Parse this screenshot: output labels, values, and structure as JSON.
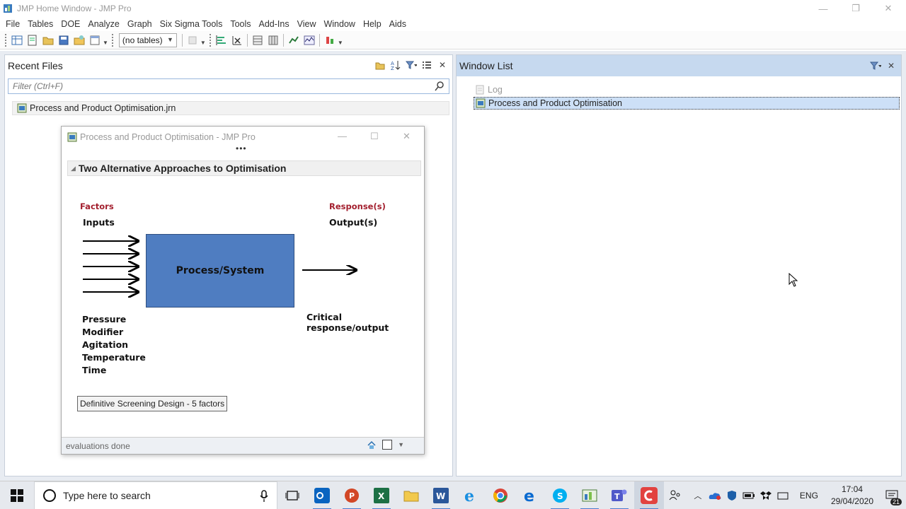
{
  "window": {
    "title": "JMP Home Window - JMP Pro"
  },
  "menu": [
    "File",
    "Tables",
    "DOE",
    "Analyze",
    "Graph",
    "Six Sigma Tools",
    "Tools",
    "Add-Ins",
    "View",
    "Window",
    "Help",
    "Aids"
  ],
  "toolbar": {
    "table_select": "(no tables)"
  },
  "recent_files": {
    "title": "Recent Files",
    "filter_placeholder": "Filter (Ctrl+F)",
    "items": [
      "Process and Product Optimisation.jrn"
    ]
  },
  "window_list": {
    "title": "Window List",
    "items": [
      {
        "label": "Log",
        "selected": false
      },
      {
        "label": "Process and Product Optimisation",
        "selected": true
      }
    ]
  },
  "journal": {
    "title": "Process and Product Optimisation - JMP Pro",
    "outline_title": "Two Alternative Approaches to Optimisation",
    "diagram": {
      "factors_label": "Factors",
      "inputs_label": "Inputs",
      "responses_label": "Response(s)",
      "outputs_label": "Output(s)",
      "box_label": "Process/System",
      "critical_label": "Critical response/output",
      "factor_list": [
        "Pressure",
        "Modifier",
        "Agitation",
        "Temperature",
        "Time"
      ]
    },
    "button_label": "Definitive Screening Design - 5 factors",
    "status_text": "evaluations done"
  },
  "taskbar": {
    "search_placeholder": "Type here to search",
    "language": "ENG",
    "time": "17:04",
    "date": "29/04/2020",
    "notification_count": "21"
  },
  "colors": {
    "accent_red": "#a31f2e",
    "process_box": "#4f7dc1",
    "panel_header": "#c6d9ef",
    "selection": "#cde0f7"
  }
}
